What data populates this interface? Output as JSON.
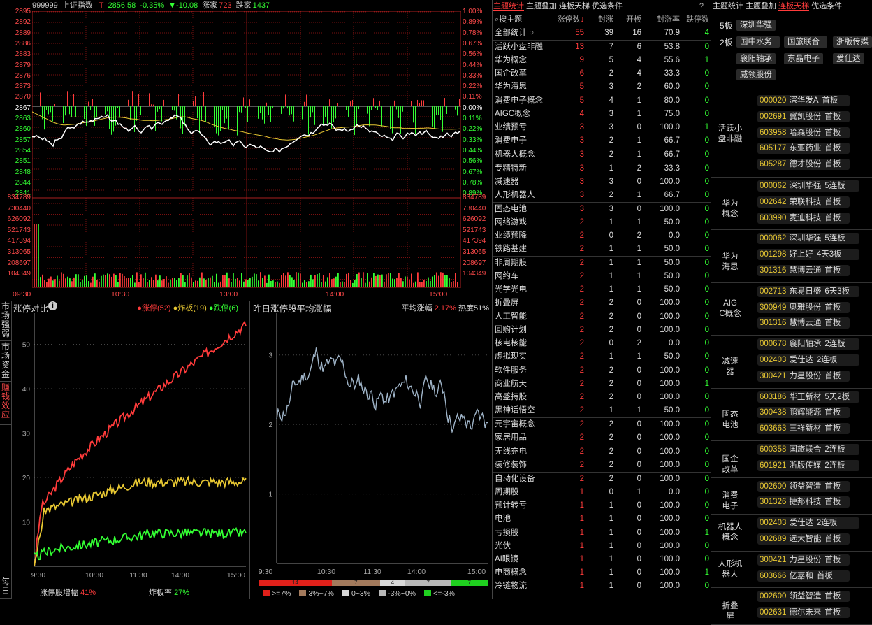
{
  "header": {
    "code": "999999",
    "name": "上证指数",
    "t_label": "T",
    "price": "2856.58",
    "pct": "-0.35%",
    "chg": "▼-10.08",
    "up_label": "涨家",
    "up": "723",
    "down_label": "跌家",
    "down": "1437"
  },
  "index_chart": {
    "price_ticks": [
      "2895",
      "2892",
      "2889",
      "2886",
      "2883",
      "2879",
      "2876",
      "2873",
      "2870",
      "2867",
      "2863",
      "2860",
      "2857",
      "2854",
      "2851",
      "2848",
      "2844",
      "2841"
    ],
    "pct_ticks": [
      "1.00%",
      "0.89%",
      "0.78%",
      "0.67%",
      "0.56%",
      "0.44%",
      "0.33%",
      "0.22%",
      "0.11%",
      "0.00%",
      "0.11%",
      "0.22%",
      "0.33%",
      "0.44%",
      "0.56%",
      "0.67%",
      "0.78%",
      "0.89%"
    ],
    "vol_ticks": [
      "834789",
      "730440",
      "626092",
      "521743",
      "417394",
      "313065",
      "208697",
      "104349"
    ],
    "time_ticks": [
      "09:30",
      "10:30",
      "13:00",
      "14:00",
      "15:00"
    ],
    "prev_close": 2867.0
  },
  "limit_compare": {
    "title": "涨停对比",
    "legend_up": "●涨停(52)",
    "legend_broken": "●炸板(19)",
    "legend_down": "●跌停(6)",
    "y_ticks": [
      "50",
      "40",
      "30",
      "20",
      "10"
    ],
    "x_ticks": [
      "9:30",
      "10:30",
      "11:30",
      "14:00",
      "15:00"
    ],
    "footer_left_label": "涨停股增幅",
    "footer_left_value": "41%",
    "footer_right_label": "炸板率",
    "footer_right_value": "27%"
  },
  "avg_rise": {
    "title": "昨日涨停股平均涨幅",
    "avg_label": "平均涨幅",
    "avg_value": "2.17%",
    "heat": "热度51%",
    "y_ticks": [
      "3",
      "2",
      "1"
    ],
    "x_ticks": [
      "9:30",
      "10:30",
      "11:30",
      "14:00",
      "15:00"
    ],
    "dist": [
      {
        "label": "14",
        "color": "#e0201a",
        "frac": 0.32
      },
      {
        "label": "7",
        "color": "#a37a5c",
        "frac": 0.21
      },
      {
        "label": "4",
        "color": "#d8d8d8",
        "frac": 0.11
      },
      {
        "label": "7",
        "color": "#b8b8b8",
        "frac": 0.2
      },
      {
        "label": "7",
        "color": "#1fd01f",
        "frac": 0.16
      }
    ],
    "legend": [
      {
        "label": ">=7%",
        "color": "#e0201a"
      },
      {
        "label": "3%~7%",
        "color": "#a37a5c"
      },
      {
        "label": "0~3%",
        "color": "#d8d8d8"
      },
      {
        "label": "-3%~0%",
        "color": "#b8b8b8"
      },
      {
        "label": "<=-3%",
        "color": "#1fd01f"
      }
    ]
  },
  "side_tabs": [
    "市场强弱",
    "市场资金",
    "赚钱效应",
    "每日"
  ],
  "theme_tabs": {
    "t1": "主题统计",
    "t2": "主题叠加",
    "t3": "连板天梯",
    "t4": "优选条件",
    "help": "?"
  },
  "theme_table": {
    "search": "搜主题",
    "cols": [
      "涨停数",
      "封涨",
      "开板",
      "封涨率",
      "跌停数"
    ],
    "rows": [
      [
        "全部统计",
        "55",
        "39",
        "16",
        "70.9",
        "4"
      ],
      [
        "活跃小盘非融",
        "13",
        "7",
        "6",
        "53.8",
        "0"
      ],
      [
        "华为概念",
        "9",
        "5",
        "4",
        "55.6",
        "1"
      ],
      [
        "国企改革",
        "6",
        "2",
        "4",
        "33.3",
        "0"
      ],
      [
        "华为海思",
        "5",
        "3",
        "2",
        "60.0",
        "0"
      ],
      [
        "消费电子概念",
        "5",
        "4",
        "1",
        "80.0",
        "0"
      ],
      [
        "AIGC概念",
        "4",
        "3",
        "1",
        "75.0",
        "0"
      ],
      [
        "业绩预亏",
        "3",
        "3",
        "0",
        "100.0",
        "1"
      ],
      [
        "消费电子",
        "3",
        "2",
        "1",
        "66.7",
        "0"
      ],
      [
        "机器人概念",
        "3",
        "2",
        "1",
        "66.7",
        "0"
      ],
      [
        "专精特新",
        "3",
        "1",
        "2",
        "33.3",
        "0"
      ],
      [
        "减速器",
        "3",
        "3",
        "0",
        "100.0",
        "0"
      ],
      [
        "人形机器人",
        "3",
        "2",
        "1",
        "66.7",
        "0"
      ],
      [
        "固态电池",
        "3",
        "3",
        "0",
        "100.0",
        "0"
      ],
      [
        "网络游戏",
        "2",
        "1",
        "1",
        "50.0",
        "0"
      ],
      [
        "业绩预降",
        "2",
        "0",
        "2",
        "0.0",
        "0"
      ],
      [
        "铁路基建",
        "2",
        "1",
        "1",
        "50.0",
        "0"
      ],
      [
        "非周期股",
        "2",
        "1",
        "1",
        "50.0",
        "0"
      ],
      [
        "网约车",
        "2",
        "1",
        "1",
        "50.0",
        "0"
      ],
      [
        "光学光电",
        "2",
        "1",
        "1",
        "50.0",
        "0"
      ],
      [
        "折叠屏",
        "2",
        "2",
        "0",
        "100.0",
        "0"
      ],
      [
        "人工智能",
        "2",
        "2",
        "0",
        "100.0",
        "0"
      ],
      [
        "回购计划",
        "2",
        "2",
        "0",
        "100.0",
        "0"
      ],
      [
        "核电核能",
        "2",
        "0",
        "2",
        "0.0",
        "0"
      ],
      [
        "虚拟现实",
        "2",
        "1",
        "1",
        "50.0",
        "0"
      ],
      [
        "软件服务",
        "2",
        "2",
        "0",
        "100.0",
        "0"
      ],
      [
        "商业航天",
        "2",
        "2",
        "0",
        "100.0",
        "1"
      ],
      [
        "高盛持股",
        "2",
        "2",
        "0",
        "100.0",
        "0"
      ],
      [
        "黑神话悟空",
        "2",
        "1",
        "1",
        "50.0",
        "0"
      ],
      [
        "元宇宙概念",
        "2",
        "2",
        "0",
        "100.0",
        "0"
      ],
      [
        "家居用品",
        "2",
        "2",
        "0",
        "100.0",
        "0"
      ],
      [
        "无线充电",
        "2",
        "2",
        "0",
        "100.0",
        "0"
      ],
      [
        "装修装饰",
        "2",
        "2",
        "0",
        "100.0",
        "0"
      ],
      [
        "自动化设备",
        "2",
        "2",
        "0",
        "100.0",
        "0"
      ],
      [
        "周期股",
        "1",
        "0",
        "1",
        "0.0",
        "0"
      ],
      [
        "预计转亏",
        "1",
        "1",
        "0",
        "100.0",
        "0"
      ],
      [
        "电池",
        "1",
        "1",
        "0",
        "100.0",
        "0"
      ],
      [
        "亏损股",
        "1",
        "1",
        "0",
        "100.0",
        "1"
      ],
      [
        "光伏",
        "1",
        "1",
        "0",
        "100.0",
        "0"
      ],
      [
        "AI眼镜",
        "1",
        "1",
        "0",
        "100.0",
        "0"
      ],
      [
        "电商概念",
        "1",
        "1",
        "0",
        "100.0",
        "1"
      ],
      [
        "冷链物流",
        "1",
        "1",
        "0",
        "100.0",
        "0"
      ]
    ]
  },
  "ladder": {
    "top_label_5": "5板",
    "top_label_2": "2板",
    "top5": [
      "深圳华强"
    ],
    "top2": [
      "国中水务",
      "国旅联合",
      "浙版传媒",
      "襄阳轴承",
      "东晶电子",
      "爱仕达",
      "威领股份"
    ],
    "groups": [
      {
        "name": "活跃小盘非融",
        "stocks": [
          [
            "000020",
            "深华发A",
            "首板"
          ],
          [
            "002691",
            "冀凯股份",
            "首板"
          ],
          [
            "603958",
            "哈森股份",
            "首板"
          ],
          [
            "605177",
            "东亚药业",
            "首板"
          ],
          [
            "605287",
            "德才股份",
            "首板"
          ]
        ]
      },
      {
        "name": "华为概念",
        "stocks": [
          [
            "000062",
            "深圳华强",
            "5连板"
          ],
          [
            "002642",
            "荣联科技",
            "首板"
          ],
          [
            "603990",
            "麦迪科技",
            "首板"
          ]
        ]
      },
      {
        "name": "华为海思",
        "stocks": [
          [
            "000062",
            "深圳华强",
            "5连板"
          ],
          [
            "001298",
            "好上好",
            "4天3板"
          ],
          [
            "301316",
            "慧博云通",
            "首板"
          ]
        ]
      },
      {
        "name": "AIGC概念",
        "stocks": [
          [
            "002713",
            "东易日盛",
            "6天3板"
          ],
          [
            "300949",
            "奥雅股份",
            "首板"
          ],
          [
            "301316",
            "慧博云通",
            "首板"
          ]
        ]
      },
      {
        "name": "减速器",
        "stocks": [
          [
            "000678",
            "襄阳轴承",
            "2连板"
          ],
          [
            "002403",
            "爱仕达",
            "2连板"
          ],
          [
            "300421",
            "力星股份",
            "首板"
          ]
        ]
      },
      {
        "name": "固态电池",
        "stocks": [
          [
            "603186",
            "华正新材",
            "5天2板"
          ],
          [
            "300438",
            "鹏辉能源",
            "首板"
          ],
          [
            "603663",
            "三祥新材",
            "首板"
          ]
        ]
      },
      {
        "name": "国企改革",
        "stocks": [
          [
            "600358",
            "国旅联合",
            "2连板"
          ],
          [
            "601921",
            "浙版传媒",
            "2连板"
          ]
        ]
      },
      {
        "name": "消费电子",
        "stocks": [
          [
            "002600",
            "领益智造",
            "首板"
          ],
          [
            "301326",
            "捷邦科技",
            "首板"
          ]
        ]
      },
      {
        "name": "机器人概念",
        "stocks": [
          [
            "002403",
            "爱仕达",
            "2连板"
          ],
          [
            "002689",
            "远大智能",
            "首板"
          ]
        ]
      },
      {
        "name": "人形机器人",
        "stocks": [
          [
            "300421",
            "力星股份",
            "首板"
          ],
          [
            "603666",
            "亿嘉和",
            "首板"
          ]
        ]
      },
      {
        "name": "折叠屏",
        "stocks": [
          [
            "002600",
            "领益智造",
            "首板"
          ],
          [
            "002631",
            "德尔未来",
            "首板"
          ]
        ]
      }
    ]
  },
  "colors": {
    "up": "#ff3b3b",
    "down": "#33ff33",
    "broken": "#e8c832",
    "grid": "#7a1010",
    "price_line": "#ffffff",
    "avg_line": "#e8c832",
    "rise_line": "#9fb4c8"
  }
}
